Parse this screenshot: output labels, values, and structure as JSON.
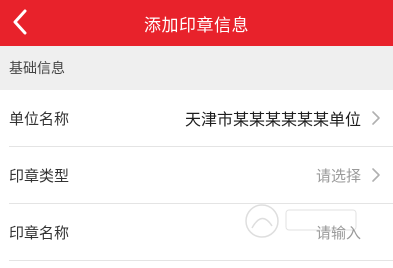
{
  "header": {
    "title": "添加印章信息",
    "back_icon": "chevron-left-icon",
    "bg_color": "#e8222b"
  },
  "section": {
    "label": "基础信息"
  },
  "fields": [
    {
      "label": "单位名称",
      "value": "天津市某某某某某某单位",
      "has_arrow": true
    },
    {
      "label": "印章类型",
      "value": "请选择",
      "has_arrow": true
    },
    {
      "label": "印章名称",
      "value": "请输入",
      "has_arrow": false
    }
  ]
}
